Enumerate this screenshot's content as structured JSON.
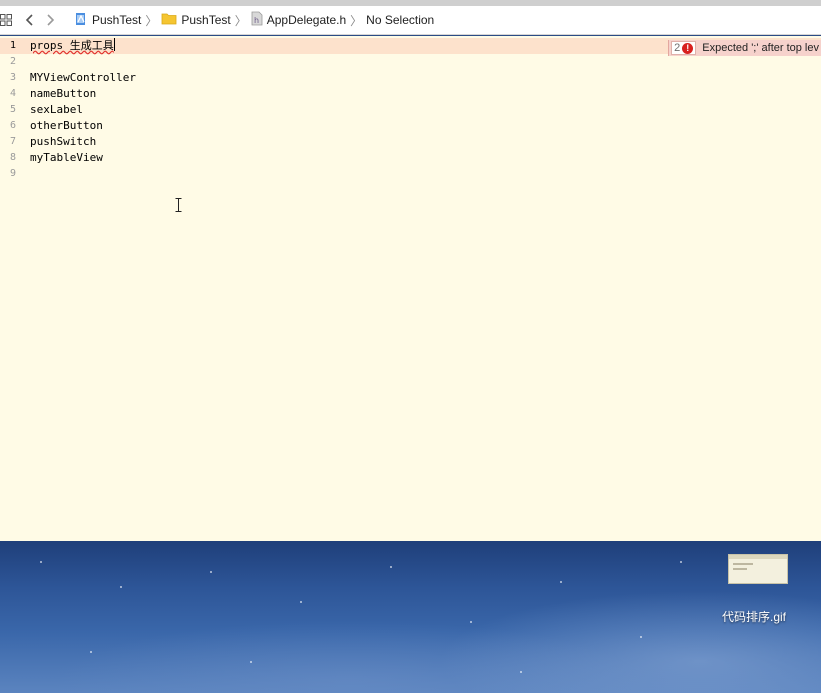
{
  "jumpbar": {
    "crumbs": [
      {
        "label": "PushTest",
        "icon": "project-icon"
      },
      {
        "label": "PushTest",
        "icon": "folder-icon"
      },
      {
        "label": "AppDelegate.h",
        "icon": "header-file-icon"
      },
      {
        "label": "No Selection",
        "icon": ""
      }
    ]
  },
  "editor": {
    "lines": [
      {
        "num": "1",
        "text": "props 生成工具"
      },
      {
        "num": "2",
        "text": ""
      },
      {
        "num": "3",
        "text": "MYViewController"
      },
      {
        "num": "4",
        "text": "nameButton"
      },
      {
        "num": "5",
        "text": "sexLabel"
      },
      {
        "num": "6",
        "text": "otherButton"
      },
      {
        "num": "7",
        "text": "pushSwitch"
      },
      {
        "num": "8",
        "text": "myTableView"
      },
      {
        "num": "9",
        "text": ""
      }
    ],
    "error": {
      "count": "2",
      "message": "Expected ';' after top lev"
    }
  },
  "desktop": {
    "file_name": "代码排序.gif"
  },
  "colors": {
    "editor_bg": "#fffbe6",
    "error_line_bg": "#fde2cc",
    "error_red": "#d8201f"
  }
}
